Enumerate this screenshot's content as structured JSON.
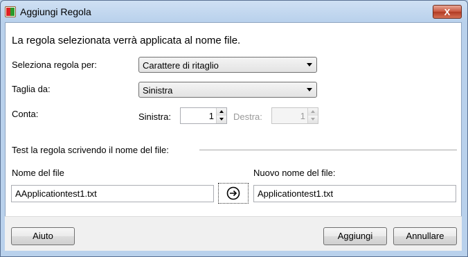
{
  "window": {
    "title": "Aggiungi Regola",
    "close_label": "X"
  },
  "description": "La regola selezionata verrà applicata al nome file.",
  "rule_select": {
    "label": "Seleziona regola per:",
    "value": "Carattere di ritaglio"
  },
  "cut_select": {
    "label": "Taglia da:",
    "value": "Sinistra"
  },
  "count": {
    "label": "Conta:",
    "left_label": "Sinistra:",
    "left_value": "1",
    "right_label": "Destra:",
    "right_value": "1"
  },
  "test_section": {
    "title": "Test la regola scrivendo il nome del file:"
  },
  "filename": {
    "label": "Nome del file",
    "value": "AApplicationtest1.txt"
  },
  "new_filename": {
    "label": "Nuovo nome del file:",
    "value": "Applicationtest1.txt"
  },
  "buttons": {
    "help": "Aiuto",
    "add": "Aggiungi",
    "cancel": "Annullare"
  }
}
